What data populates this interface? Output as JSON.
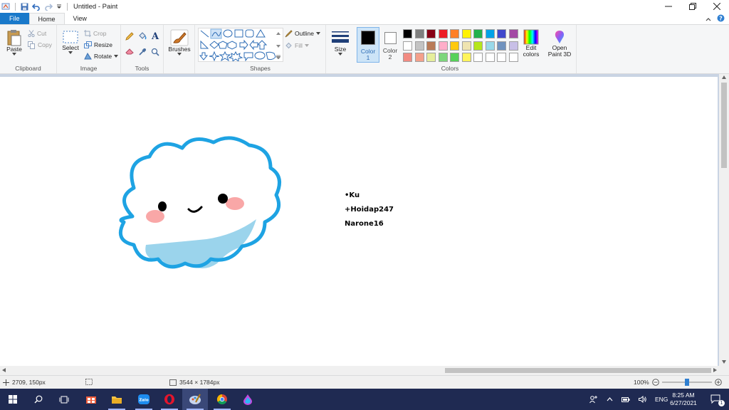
{
  "window": {
    "title": "Untitled - Paint"
  },
  "menu": {
    "file": "File",
    "home": "Home",
    "view": "View"
  },
  "clipboard": {
    "label": "Clipboard",
    "paste": "Paste",
    "cut": "Cut",
    "copy": "Copy"
  },
  "image": {
    "label": "Image",
    "select": "Select",
    "crop": "Crop",
    "resize": "Resize",
    "rotate": "Rotate"
  },
  "tools": {
    "label": "Tools"
  },
  "brushes": {
    "label": "Brushes"
  },
  "shapes": {
    "label": "Shapes",
    "outline": "Outline",
    "fill": "Fill"
  },
  "size": {
    "label": "Size"
  },
  "color1": {
    "label": "Color",
    "num": "1",
    "value": "#000000"
  },
  "color2": {
    "label": "Color",
    "num": "2",
    "value": "#ffffff"
  },
  "colors": {
    "label": "Colors",
    "edit_line1": "Edit",
    "edit_line2": "colors",
    "palette_row1": [
      "#000000",
      "#7f7f7f",
      "#880015",
      "#ed1c24",
      "#ff7f27",
      "#fff200",
      "#22b14c",
      "#00a2e8",
      "#3f48cc",
      "#a349a4"
    ],
    "palette_row2": [
      "#ffffff",
      "#c3c3c3",
      "#b97a57",
      "#ffaec9",
      "#ffc90e",
      "#efe4b0",
      "#b5e61d",
      "#99d9ea",
      "#7092be",
      "#c8bfe7"
    ],
    "palette_row3": [
      "#f28b82",
      "#f4a08b",
      "#e6ee9c",
      "#7cd67c",
      "#57d15a",
      "#fff45c",
      "#ffffff",
      "#ffffff",
      "#ffffff",
      "#ffffff"
    ]
  },
  "paint3d": {
    "line1": "Open",
    "line2": "Paint 3D"
  },
  "canvas_text": {
    "line1": "•Ku",
    "line2": "+Hoidap247",
    "line3": "Narone16"
  },
  "status": {
    "cursor_pos": "2709, 150px",
    "image_size": "3544 × 1784px",
    "zoom": "100%"
  },
  "taskbar": {
    "language": "ENG",
    "time": "8:25 AM",
    "date": "6/27/2021",
    "notifications": "1"
  }
}
